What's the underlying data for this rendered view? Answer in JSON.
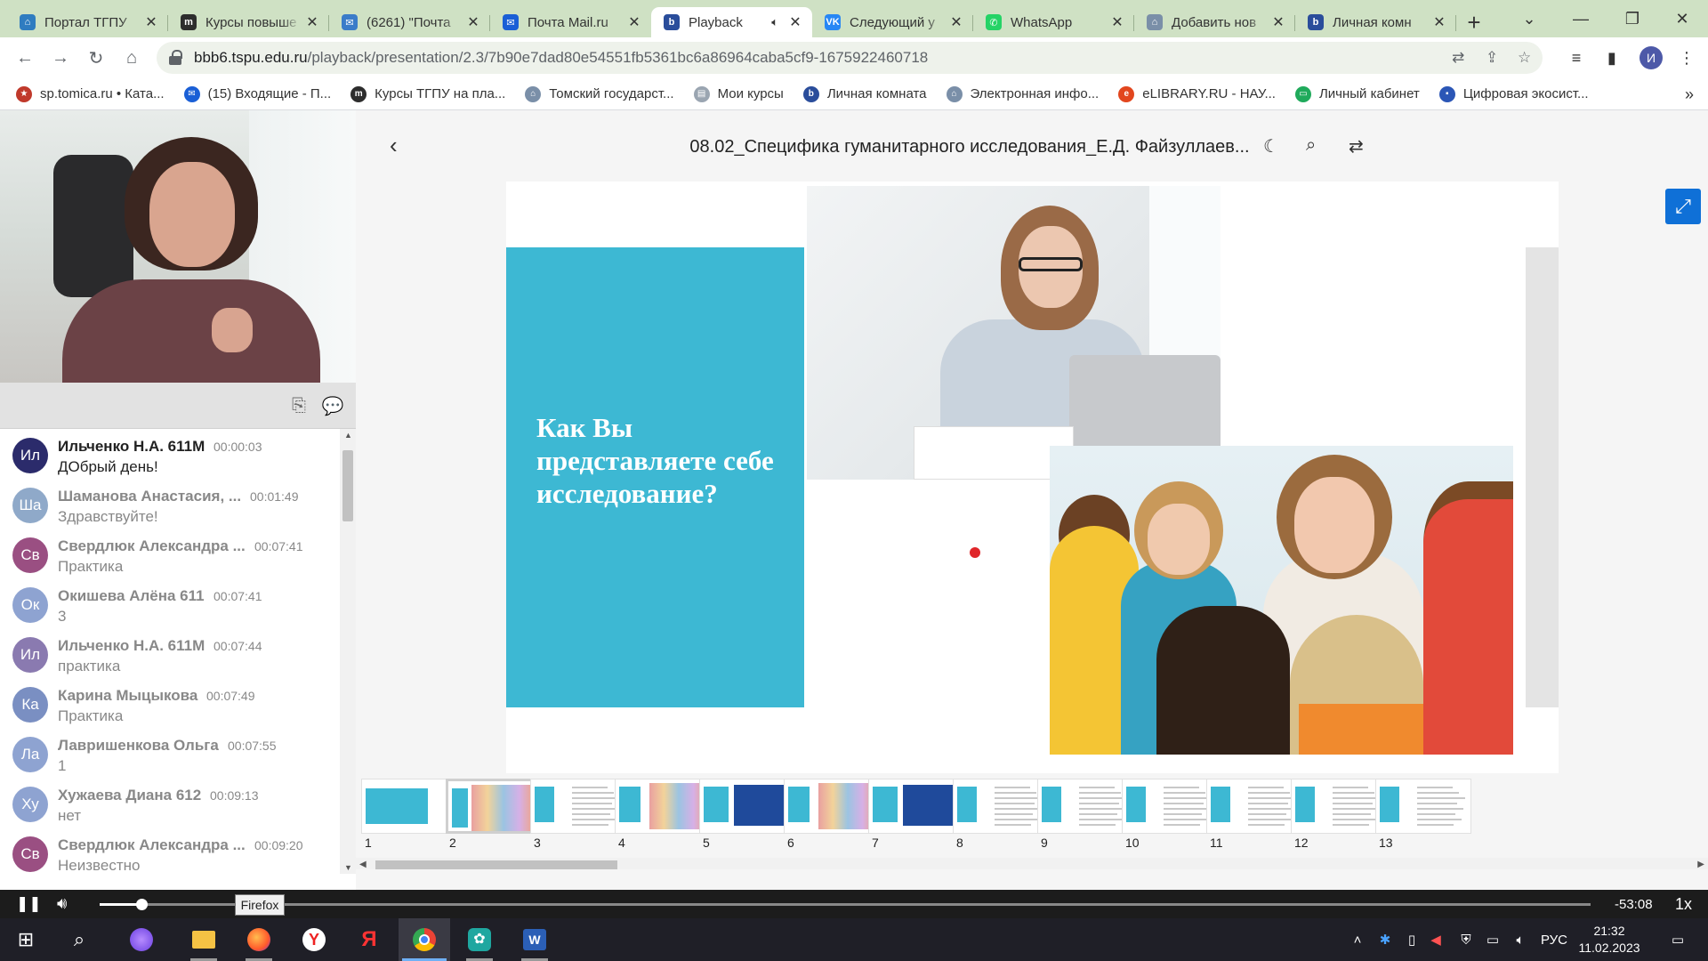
{
  "browser": {
    "tabs": [
      {
        "title": "Портал ТГПУ",
        "icon": "globe-icon",
        "color": "#2f7cc0",
        "glyph": "⌂"
      },
      {
        "title": "Курсы повыше",
        "icon": "m-logo-icon",
        "color": "#2d2d2d",
        "glyph": "m"
      },
      {
        "title": "(6261) \"Почта",
        "icon": "mail-bird-icon",
        "color": "#3b7cc9",
        "glyph": "✉"
      },
      {
        "title": "Почта Mail.ru",
        "icon": "mailru-icon",
        "color": "#1a5fd6",
        "glyph": "✉"
      },
      {
        "title": "Playback",
        "icon": "bbb-icon",
        "color": "#2a4d9b",
        "glyph": "b",
        "active": true,
        "audio": true
      },
      {
        "title": "Следующий у",
        "icon": "vk-icon",
        "color": "#2787f5",
        "glyph": "VK"
      },
      {
        "title": "WhatsApp",
        "icon": "whatsapp-icon",
        "color": "#25d366",
        "glyph": "✆"
      },
      {
        "title": "Добавить нов",
        "icon": "globe-icon",
        "color": "#7a8fa8",
        "glyph": "⌂"
      },
      {
        "title": "Личная комн",
        "icon": "bbb-icon",
        "color": "#2a4d9b",
        "glyph": "b"
      }
    ],
    "url_host": "bbb6.tspu.edu.ru",
    "url_path": "/playback/presentation/2.3/7b90e7dad80e54551fb5361bc6a86964caba5cf9-1675922460718",
    "profile_initial": "И",
    "bookmarks": [
      {
        "label": "sp.tomica.ru • Ката...",
        "color": "#c0392b",
        "glyph": "★"
      },
      {
        "label": "(15) Входящие - П...",
        "color": "#1a5fd6",
        "glyph": "✉"
      },
      {
        "label": "Курсы ТГПУ на пла...",
        "color": "#2d2d2d",
        "glyph": "m"
      },
      {
        "label": "Томский государст...",
        "color": "#7a8fa8",
        "glyph": "⌂"
      },
      {
        "label": "Мои курсы",
        "color": "#9aa5b1",
        "glyph": "▤"
      },
      {
        "label": "Личная комната",
        "color": "#2a4d9b",
        "glyph": "b"
      },
      {
        "label": "Электронная инфо...",
        "color": "#7a8fa8",
        "glyph": "⌂"
      },
      {
        "label": "eLIBRARY.RU - НАУ...",
        "color": "#e2461e",
        "glyph": "e"
      },
      {
        "label": "Личный кабинет",
        "color": "#1faa5b",
        "glyph": "▭"
      },
      {
        "label": "Цифровая экосист...",
        "color": "#2b56b6",
        "glyph": "▪"
      }
    ]
  },
  "presentation": {
    "title": "08.02_Специфика гуманитарного исследования_Е.Д. Файзуллаев...",
    "slide_question": "Как Вы представляете себе исследование?"
  },
  "chat": {
    "messages": [
      {
        "initials": "Ил",
        "color": "#2b2b6b",
        "name": "Ильченко Н.А. 611М",
        "time": "00:00:03",
        "text": "ДОбрый день!"
      },
      {
        "initials": "Ша",
        "color": "#8fa9c9",
        "name": "Шаманова Анастасия, ...",
        "time": "00:01:49",
        "text": "Здравствуйте!"
      },
      {
        "initials": "Св",
        "color": "#9a4f82",
        "name": "Свердлюк Александра ...",
        "time": "00:07:41",
        "text": "Практика"
      },
      {
        "initials": "Ок",
        "color": "#8ea3d1",
        "name": "Окишева Алёна 611",
        "time": "00:07:41",
        "text": "3"
      },
      {
        "initials": "Ил",
        "color": "#8a7ab0",
        "name": "Ильченко Н.А. 611М",
        "time": "00:07:44",
        "text": "практика"
      },
      {
        "initials": "Ка",
        "color": "#7a8fc2",
        "name": "Карина Мыцыкова",
        "time": "00:07:49",
        "text": "Практика"
      },
      {
        "initials": "Ла",
        "color": "#8ea3d1",
        "name": "Лавришенкова Ольга",
        "time": "00:07:55",
        "text": "1"
      },
      {
        "initials": "Ху",
        "color": "#8ea3d1",
        "name": "Хужаева Диана 612",
        "time": "00:09:13",
        "text": "нет"
      },
      {
        "initials": "Св",
        "color": "#9a4f82",
        "name": "Свердлюк Александра ...",
        "time": "00:09:20",
        "text": "Неизвестно"
      }
    ]
  },
  "thumbnails": {
    "numbers": [
      "1",
      "2",
      "3",
      "4",
      "5",
      "6",
      "7",
      "8",
      "9",
      "10",
      "11",
      "12",
      "13"
    ],
    "current": 2
  },
  "player": {
    "remaining": "-53:08",
    "speed": "1x",
    "progress": 0.028,
    "tooltip": "Firefox"
  },
  "taskbar": {
    "language": "РУС",
    "time": "21:32",
    "date": "11.02.2023"
  }
}
